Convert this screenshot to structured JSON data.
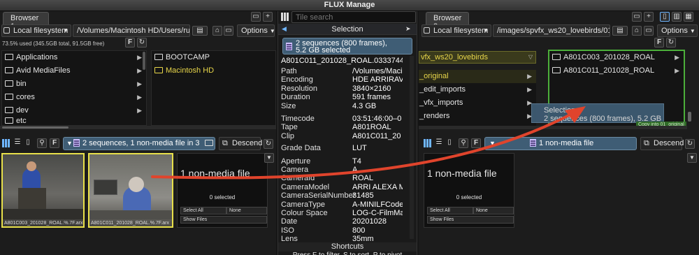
{
  "app": {
    "title": "FLUX Manage"
  },
  "left": {
    "tab": "Browser 1",
    "location": "Local filesystem",
    "path": "/Volumes/Macintosh HD/Users/rul",
    "options": "Options",
    "usage": "73.5% used (345.5GB total, 91.5GB free)",
    "col1": [
      "Applications",
      "Avid MediaFiles",
      "bin",
      "cores",
      "dev",
      "etc"
    ],
    "col2": [
      "BOOTCAMP",
      "Macintosh HD"
    ],
    "summary": "2 sequences, 1 non-media file in 3",
    "sort": "Descend",
    "thumbs": [
      "A801C003_201028_ROAL.%.7F.arx",
      "A801C011_201028_ROAL.%.7F.arx"
    ],
    "card": {
      "title": "1 non-media file",
      "selected": "0 selected",
      "select_all": "Select All",
      "none": "None",
      "show_files": "Show Files"
    }
  },
  "center": {
    "search_placeholder": "Tile search",
    "selection_title": "Selection",
    "badge_line1": "2 sequences (800 frames),",
    "badge_line2": "5.2 GB selected",
    "clip_name": "A801C011_201028_ROAL.0333744.",
    "props": [
      {
        "label": "Path",
        "value": "/Volumes/Maci"
      },
      {
        "label": "Encoding",
        "value": "HDE ARRIRAV"
      },
      {
        "label": "Resolution",
        "value": "3840×2160"
      },
      {
        "label": "Duration",
        "value": "591 frames"
      },
      {
        "label": "Size",
        "value": "4.3 GB"
      },
      {
        "label": "Timecode",
        "value": "03:51:46:00–0"
      },
      {
        "label": "Tape",
        "value": "A801ROAL"
      },
      {
        "label": "Clip",
        "value": "A801C011_20"
      },
      {
        "label": "Grade Data",
        "value": "LUT"
      },
      {
        "label": "Aperture",
        "value": "T4"
      },
      {
        "label": "Camera",
        "value": "A"
      },
      {
        "label": "CameraId",
        "value": "ROAL"
      },
      {
        "label": "CameraModel",
        "value": "ARRI ALEXA M"
      },
      {
        "label": "CameraSerialNumber",
        "value": "31485"
      },
      {
        "label": "CameraType",
        "value": "A-MINILFCode"
      },
      {
        "label": "Colour Space",
        "value": "LOG-C-FilmMa"
      },
      {
        "label": "Date",
        "value": "20201028"
      },
      {
        "label": "ISO",
        "value": "800"
      },
      {
        "label": "Lens",
        "value": "35mm"
      }
    ],
    "shortcuts_title": "Shortcuts",
    "shortcuts_text": "Press F to filter, S to sort, P to pivot"
  },
  "right": {
    "tab": "Browser 2",
    "location": "Local filesystem",
    "path": "/images/spvfx_ws20_lovebirds/01",
    "options": "Options",
    "dropdown": "vfx_ws20_lovebirds",
    "col1": [
      "_original",
      "_edit_imports",
      "_vfx_imports",
      "_renders"
    ],
    "col2": [
      "A801C003_201028_ROAL",
      "A801C011_201028_ROAL"
    ],
    "drag_title": "Selection",
    "drag_text": "2 sequences (800 frames), 5.2 GB",
    "copy_hint": "Copy into 01_original",
    "summary": "1 non-media file",
    "sort": "Descend",
    "card": {
      "title": "1 non-media file",
      "selected": "0 selected",
      "select_all": "Select All",
      "none": "None",
      "show_files": "Show Files"
    }
  },
  "colors": {
    "accent_yellow": "#e8e04a",
    "drop_green": "#4caf3a",
    "badge_blue": "#3f5d75",
    "arrow_red": "#e0442c"
  }
}
